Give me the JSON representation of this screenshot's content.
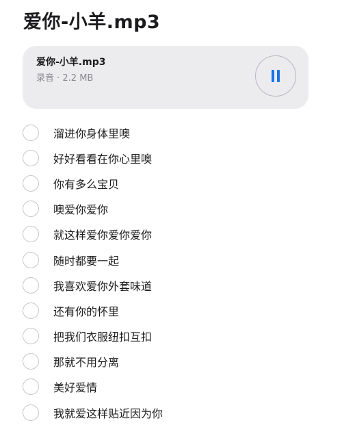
{
  "note": {
    "title": "爱你-小羊.mp3"
  },
  "attachment": {
    "name": "爱你-小羊.mp3",
    "meta": "录音 · 2.2 MB",
    "play_state": "pause-icon",
    "accent_color": "#1a73e8"
  },
  "checklist": {
    "items": [
      {
        "text": "溜进你身体里噢",
        "checked": false
      },
      {
        "text": "好好看看在你心里噢",
        "checked": false
      },
      {
        "text": "你有多么宝贝",
        "checked": false
      },
      {
        "text": "噢爱你爱你",
        "checked": false
      },
      {
        "text": "就这样爱你爱你爱你",
        "checked": false
      },
      {
        "text": "随时都要一起",
        "checked": false
      },
      {
        "text": "我喜欢爱你外套味道",
        "checked": false
      },
      {
        "text": "还有你的怀里",
        "checked": false
      },
      {
        "text": "把我们衣服纽扣互扣",
        "checked": false
      },
      {
        "text": "那就不用分离",
        "checked": false
      },
      {
        "text": "美好爱情",
        "checked": false
      },
      {
        "text": "我就爱这样贴近因为你",
        "checked": false
      }
    ]
  }
}
